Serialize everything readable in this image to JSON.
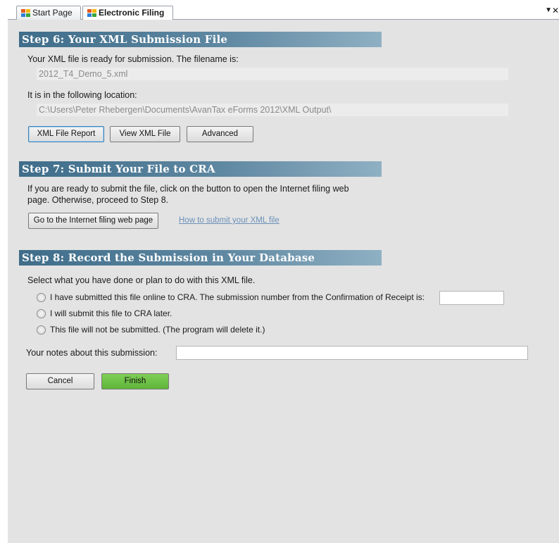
{
  "tabs": [
    {
      "label": "Start Page"
    },
    {
      "label": "Electronic Filing"
    }
  ],
  "step6": {
    "title": "Step 6: Your XML Submission File",
    "ready_text": "Your XML file is ready for submission. The filename is:",
    "filename": "2012_T4_Demo_5.xml",
    "location_label": "It is in the following location:",
    "location": "C:\\Users\\Peter Rhebergen\\Documents\\AvanTax eForms 2012\\XML Output\\",
    "buttons": {
      "report": "XML File Report",
      "view": "View XML File",
      "advanced": "Advanced"
    }
  },
  "step7": {
    "title": "Step 7: Submit Your File to CRA",
    "line1": "If you are ready to submit the file, click on the button to open the Internet filing web",
    "line2": "page. Otherwise, proceed to Step 8.",
    "go_button": "Go to the Internet filing web page",
    "how_link": "How to submit your XML file"
  },
  "step8": {
    "title": "Step 8: Record the Submission in Your Database",
    "prompt": "Select what you have done or plan to do with this XML file.",
    "options": [
      {
        "label": "I have submitted this file online to CRA. The submission number from the Confirmation of Receipt is:"
      },
      {
        "label": "I will submit this file to CRA later."
      },
      {
        "label": "This file will not be submitted. (The program will delete it.)"
      }
    ],
    "submission_number": "",
    "notes_label": "Your notes about this submission:",
    "notes_value": ""
  },
  "footer": {
    "cancel": "Cancel",
    "finish": "Finish"
  }
}
